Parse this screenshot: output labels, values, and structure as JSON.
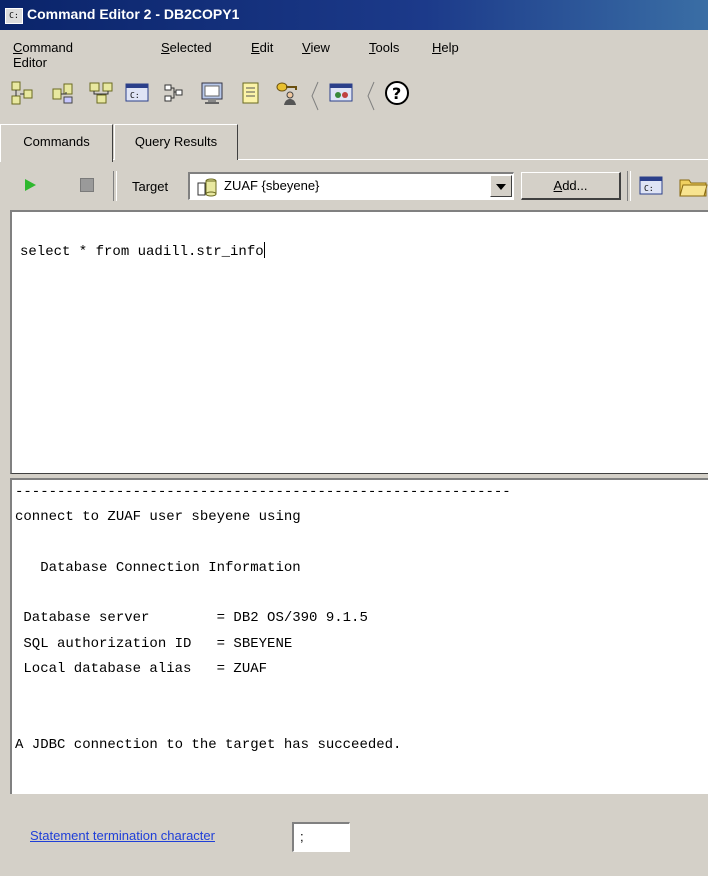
{
  "window": {
    "title": "Command Editor 2 - DB2COPY1",
    "icon": "cmd-window-icon",
    "icon_text": "C:"
  },
  "menubar": {
    "items": [
      "Command Editor",
      "Selected",
      "Edit",
      "View",
      "Tools",
      "Help"
    ],
    "mnemonics": [
      "C",
      "S",
      "E",
      "V",
      "T",
      "H"
    ]
  },
  "toolbar": {
    "icons": [
      "db-tree-icon",
      "db-connect-icon",
      "db-hierarchy-icon",
      "command-window-icon",
      "network-icon",
      "task-center-icon",
      "journal-icon",
      "key-user-icon",
      "console-icon",
      "help-icon"
    ]
  },
  "tabs": [
    {
      "label": "Commands",
      "active": true
    },
    {
      "label": "Query Results",
      "active": false
    }
  ],
  "command_bar": {
    "target_label": "Target",
    "target_value": "ZUAF {sbeyene}",
    "add_button": "Add..."
  },
  "editor": {
    "text": "select * from uadill.str_info"
  },
  "output": {
    "lines": [
      "-----------------------------------------------------------",
      "connect to ZUAF user sbeyene using",
      "",
      "   Database Connection Information",
      "",
      " Database server        = DB2 OS/390 9.1.5",
      " SQL authorization ID   = SBEYENE",
      " Local database alias   = ZUAF",
      "",
      "",
      "A JDBC connection to the target has succeeded."
    ]
  },
  "statusbar": {
    "termination_label": "Statement termination character",
    "termination_value": ";"
  },
  "colors": {
    "titlebar": "#0a246a",
    "link": "#1f3fd8",
    "run": "#2eb82e"
  }
}
